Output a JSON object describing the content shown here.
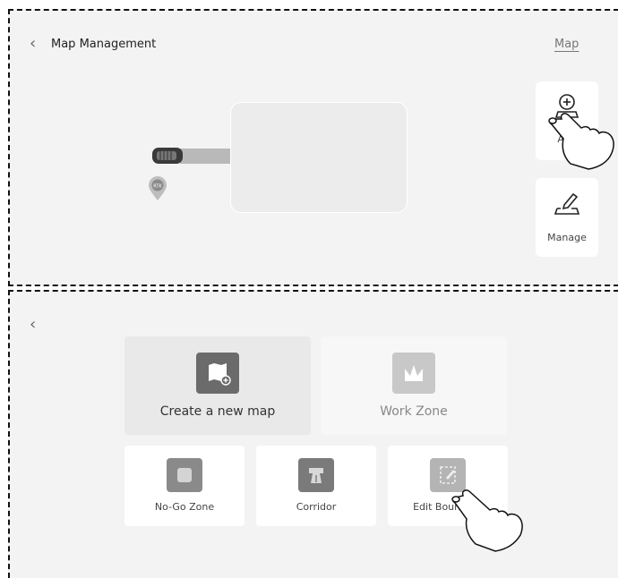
{
  "top_panel": {
    "back_icon": "chevron-left-icon",
    "title": "Map Management",
    "map_link": "Map",
    "add_button_label": "Add",
    "manage_button_label": "Manage",
    "rtk_label": "RTK"
  },
  "bottom_panel": {
    "back_icon": "chevron-left-icon",
    "cards": {
      "create": "Create a new map",
      "work_zone": "Work Zone",
      "no_go": "No-Go Zone",
      "corridor": "Corridor",
      "edit_boundary": "Edit Boundary"
    }
  },
  "colors": {
    "panel_bg": "#f3f3f3",
    "selected_card": "#e9e9e9",
    "icon_dark": "#6b6b6b",
    "icon_light": "#c8c8c8"
  }
}
